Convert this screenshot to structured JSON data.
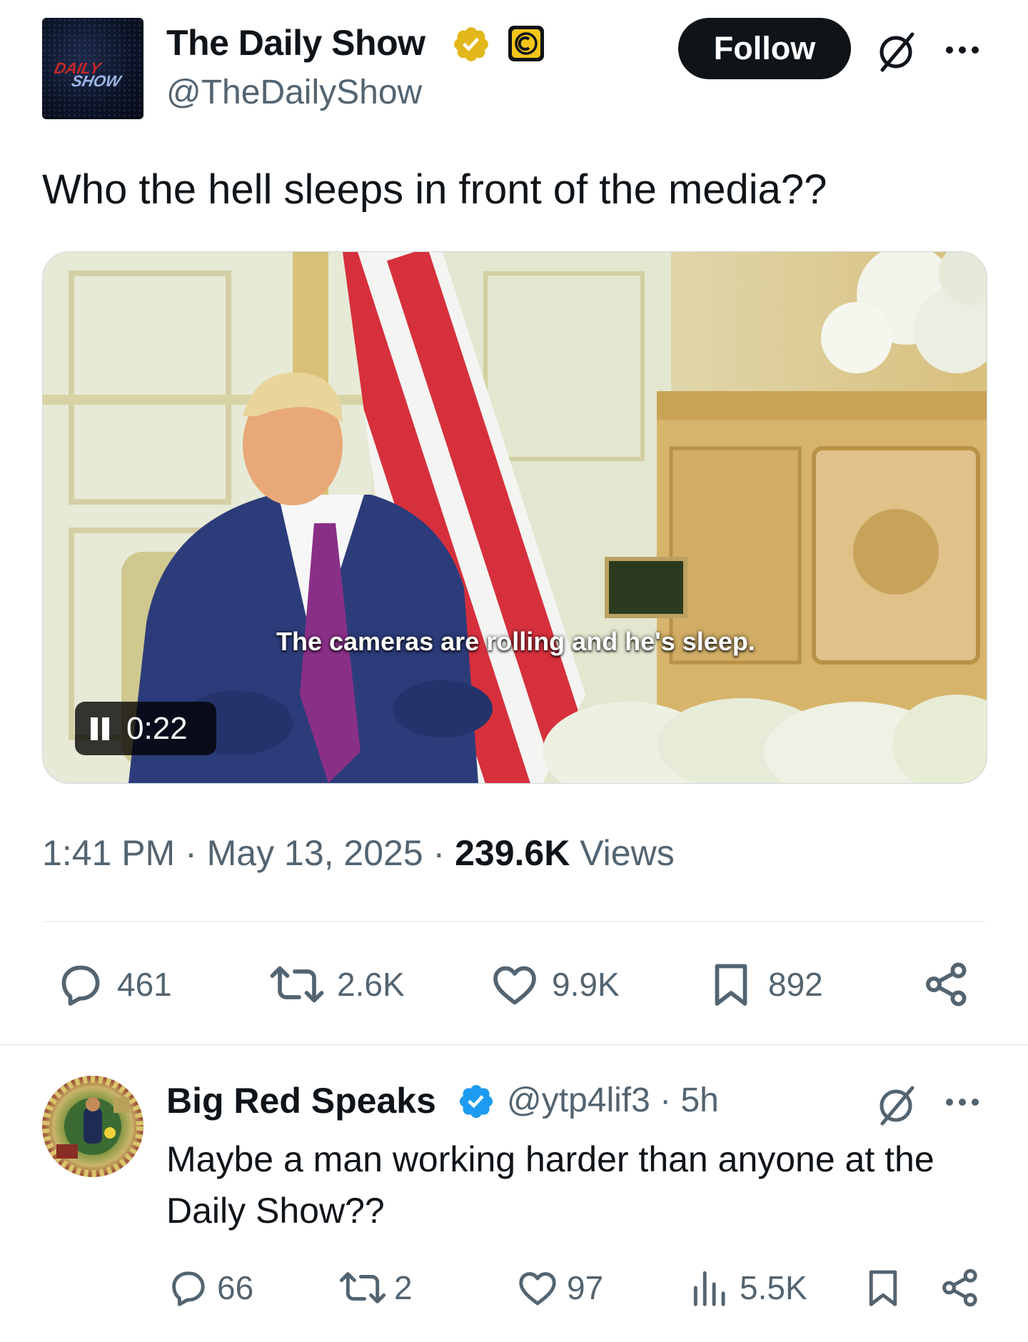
{
  "tweet": {
    "author": {
      "name": "The Daily Show",
      "handle": "@TheDailyShow",
      "avatar_logo_top": "DAILY",
      "avatar_logo_bottom": "SHOW",
      "verified": "gold",
      "affiliate_badge": "comedy-central-logo"
    },
    "follow_label": "Follow",
    "text": "Who the hell sleeps in front of the media??",
    "video": {
      "caption": "The cameras are rolling and he's sleep.",
      "duration": "0:22",
      "state": "playing"
    },
    "meta": {
      "time": "1:41 PM",
      "separator": " · ",
      "date": "May 13, 2025",
      "views_count": "239.6K",
      "views_label": "Views"
    },
    "actions": {
      "replies": "461",
      "reposts": "2.6K",
      "likes": "9.9K",
      "bookmarks": "892"
    }
  },
  "reply": {
    "author": {
      "name": "Big Red Speaks",
      "handle": "@ytp4lif3",
      "time": "5h",
      "verified": "blue"
    },
    "text": "Maybe a man working harder than anyone at the Daily Show??",
    "actions": {
      "replies": "66",
      "reposts": "2",
      "likes": "97",
      "views": "5.5K"
    }
  },
  "colors": {
    "text": "#0f1419",
    "secondary": "#536471",
    "verified_gold": "#e2b719",
    "verified_blue": "#1d9bf0",
    "follow_bg": "#0f1419"
  }
}
